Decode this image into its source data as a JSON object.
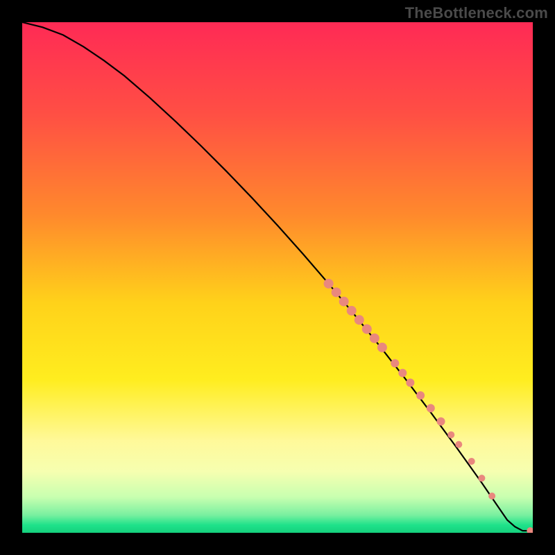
{
  "attribution": "TheBottleneck.com",
  "colors": {
    "dot": "#e9887e",
    "curve": "#000000",
    "green": "#1ee28a",
    "black": "#000000"
  },
  "chart_data": {
    "type": "line",
    "title": "",
    "xlabel": "",
    "ylabel": "",
    "xlim": [
      0,
      100
    ],
    "ylim": [
      0,
      100
    ],
    "curve": {
      "x": [
        0,
        4,
        8,
        12,
        16,
        20,
        25,
        30,
        35,
        40,
        45,
        50,
        55,
        60,
        65,
        70,
        75,
        80,
        85,
        90,
        93,
        95,
        96.5,
        98,
        100
      ],
      "y": [
        100,
        99,
        97.5,
        95.2,
        92.5,
        89.5,
        85.2,
        80.6,
        75.8,
        70.8,
        65.6,
        60.2,
        54.6,
        48.8,
        42.8,
        36.6,
        30.2,
        23.6,
        16.8,
        9.8,
        5.4,
        2.5,
        1.2,
        0.4,
        0.4
      ]
    },
    "dots": {
      "x": [
        60,
        61.5,
        63,
        64.5,
        66,
        67.5,
        69,
        70.5,
        73,
        74.5,
        76,
        78,
        80,
        82,
        84,
        85.5,
        88,
        90,
        92,
        99.5
      ],
      "y": [
        48.8,
        47.1,
        45.3,
        43.5,
        41.7,
        39.9,
        38.1,
        36.3,
        33.2,
        31.3,
        29.4,
        26.9,
        24.4,
        21.8,
        19.2,
        17.3,
        14.0,
        10.7,
        7.2,
        0.4
      ],
      "r": [
        7,
        7,
        7,
        7,
        7,
        7,
        7,
        7,
        6,
        6,
        6,
        6,
        6,
        6,
        5,
        5,
        5,
        5,
        5,
        5
      ]
    },
    "gradient_bands": [
      {
        "stop": 0.0,
        "color": "#ff2a55"
      },
      {
        "stop": 0.18,
        "color": "#ff4f44"
      },
      {
        "stop": 0.38,
        "color": "#ff8a2c"
      },
      {
        "stop": 0.55,
        "color": "#ffd21a"
      },
      {
        "stop": 0.7,
        "color": "#ffed1f"
      },
      {
        "stop": 0.82,
        "color": "#fff99a"
      },
      {
        "stop": 0.88,
        "color": "#f6ffb0"
      },
      {
        "stop": 0.93,
        "color": "#c8ffb0"
      },
      {
        "stop": 0.965,
        "color": "#7af0a0"
      },
      {
        "stop": 0.985,
        "color": "#1ee28a"
      },
      {
        "stop": 1.0,
        "color": "#15d07d"
      }
    ]
  }
}
